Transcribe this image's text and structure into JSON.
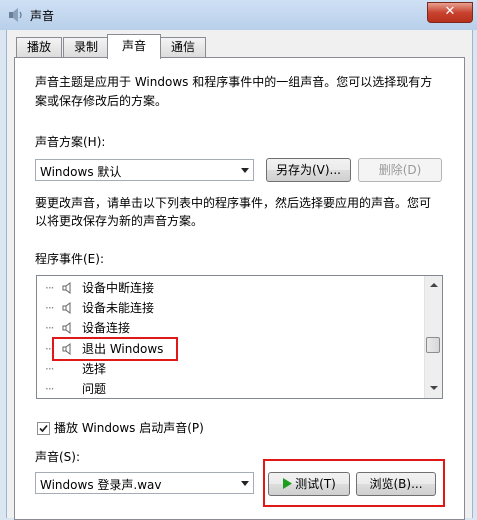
{
  "window": {
    "title": "声音",
    "close_symbol": "✕"
  },
  "tabs": [
    {
      "label": "播放"
    },
    {
      "label": "录制"
    },
    {
      "label": "声音"
    },
    {
      "label": "通信"
    }
  ],
  "description": {
    "line1": "声音主题是应用于 Windows 和程序事件中的一组声音。您可以选择现有方",
    "line2": "案或保存修改后的方案。"
  },
  "scheme": {
    "label": "声音方案(H):",
    "selected": "Windows 默认",
    "save_as_label": "另存为(V)...",
    "delete_label": "删除(D)"
  },
  "instructions": {
    "line1": "要更改声音，请单击以下列表中的程序事件，然后选择要应用的声音。您可",
    "line2": "以将更改保存为新的声音方案。"
  },
  "events": {
    "label": "程序事件(E):",
    "items": [
      {
        "label": "设备中断连接",
        "has_speaker": true
      },
      {
        "label": "设备未能连接",
        "has_speaker": true
      },
      {
        "label": "设备连接",
        "has_speaker": true
      },
      {
        "label": "退出 Windows",
        "has_speaker": true,
        "highlighted": true
      },
      {
        "label": "选择",
        "has_speaker": false
      },
      {
        "label": "问题",
        "has_speaker": false
      }
    ]
  },
  "startup_sound": {
    "label": "播放 Windows 启动声音(P)",
    "checked": true
  },
  "sound": {
    "label": "声音(S):",
    "selected": "Windows 登录声.wav",
    "test_label": "测试(T)",
    "browse_label": "浏览(B)..."
  },
  "colors": {
    "highlight_red": "#e01818",
    "play_green": "#1e9e1e"
  }
}
